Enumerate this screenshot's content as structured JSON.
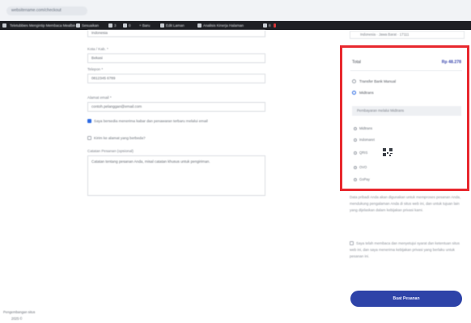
{
  "browser": {
    "url": "websitename.com/checkout"
  },
  "adminbar": {
    "items": [
      "Teletubbies Mengintip Membaca Mealbin",
      "Sesuaikan",
      "3",
      "0",
      "+ Baru",
      "Edit Laman",
      "Analisis Kinerja Halaman",
      "8"
    ]
  },
  "form": {
    "field_top": "Indonesia",
    "city_label": "Kota / Kab. *",
    "city_value": "Bekasi",
    "phone_label": "Telepon *",
    "phone_value": "0812345 6789",
    "email_label": "Alamat email *",
    "email_value": "contoh.pelanggan@email.com",
    "consent_label": "Saya bersedia menerima kabar dan penawaran terbaru melalui email",
    "ship_label": "Kirim ke alamat yang berbeda?",
    "notes_label": "Catatan Pesanan (opsional)",
    "notes_value": "Catatan tentang pesanan Anda, misal catatan khusus untuk pengiriman."
  },
  "right": {
    "top_field": "Indonesia · Jawa Barat · 17111",
    "total_label": "Total",
    "total_value": "Rp 48.278",
    "payment_options": {
      "bank": "Transfer Bank Manual",
      "selected": "Midtrans"
    },
    "notice": "Pembayaran melalui Midtrans",
    "methods": [
      "Midtrans",
      "Indomaret",
      "QRIS",
      "OVO",
      "GoPay"
    ],
    "privacy": "Data pribadi Anda akan digunakan untuk memproses pesanan Anda, mendukung pengalaman Anda di situs web ini, dan untuk tujuan lain yang dijelaskan dalam kebijakan privasi kami.",
    "terms": "Saya telah membaca dan menyetujui syarat dan ketentuan situs web ini, dan saya menerima kebijakan privasi yang berlaku untuk pesanan ini.",
    "order_button": "Buat Pesanan"
  },
  "footer": {
    "line1": "Pengembangan situs",
    "line2": "2025 ©"
  }
}
